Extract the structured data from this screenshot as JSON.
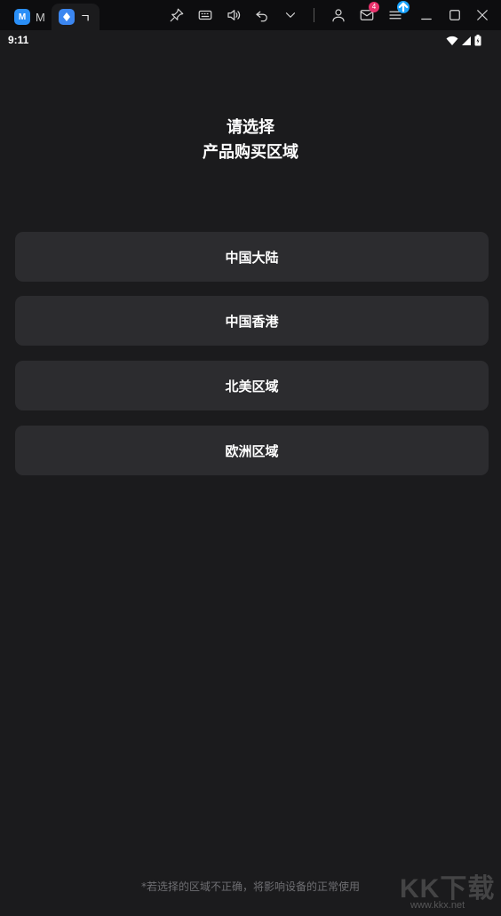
{
  "window": {
    "tabs": [
      {
        "label": "M",
        "icon": "app-m-icon"
      },
      {
        "label": "ㄱ",
        "icon": "app-icon"
      }
    ],
    "mail_badge": "4"
  },
  "status_bar": {
    "time": "9:11"
  },
  "header": {
    "title_line1": "请选择",
    "title_line2": "产品购买区域"
  },
  "regions": [
    {
      "label": "中国大陆"
    },
    {
      "label": "中国香港"
    },
    {
      "label": "北美区域"
    },
    {
      "label": "欧洲区域"
    }
  ],
  "footer": {
    "note": "*若选择的区域不正确，将影响设备的正常使用"
  },
  "watermark": {
    "brand": "KK下载",
    "url": "www.kkx.net"
  },
  "colors": {
    "background": "#1b1b1d",
    "button": "#2c2c2f",
    "accent": "#2a8ff7",
    "badge": "#e8316b"
  }
}
